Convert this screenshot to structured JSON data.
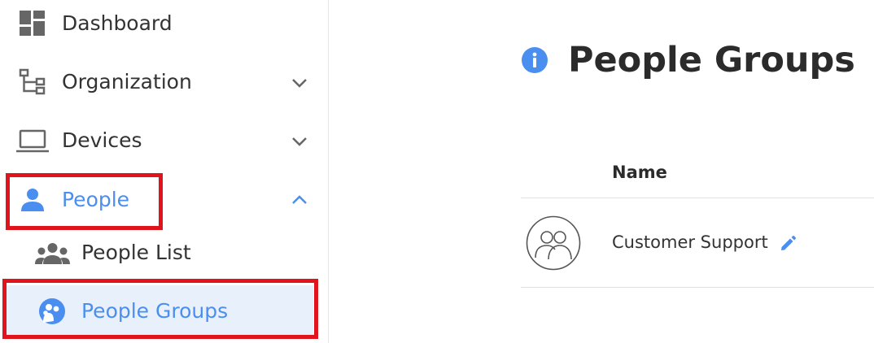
{
  "sidebar": {
    "items": [
      {
        "label": "Dashboard",
        "icon": "dashboard-icon"
      },
      {
        "label": "Organization",
        "icon": "organization-icon",
        "chevron": "chevron-down-icon"
      },
      {
        "label": "Devices",
        "icon": "laptop-icon",
        "chevron": "chevron-down-icon"
      },
      {
        "label": "People",
        "icon": "person-icon",
        "chevron": "chevron-up-icon",
        "expanded": true
      },
      {
        "label": "People List",
        "icon": "people-list-icon"
      },
      {
        "label": "People Groups",
        "icon": "people-groups-icon",
        "selected": true
      }
    ]
  },
  "main": {
    "title": "People Groups",
    "info_icon": "info-icon",
    "table": {
      "columns": [
        "Name"
      ],
      "rows": [
        {
          "name": "Customer Support",
          "avatar": "group-avatar-icon",
          "action_icon": "edit-icon"
        }
      ]
    }
  },
  "colors": {
    "accent": "#4a8ff0",
    "icon_gray": "#666666",
    "text": "#333333",
    "selected_bg": "#e8f0fb",
    "highlight_border": "#e0141c"
  }
}
